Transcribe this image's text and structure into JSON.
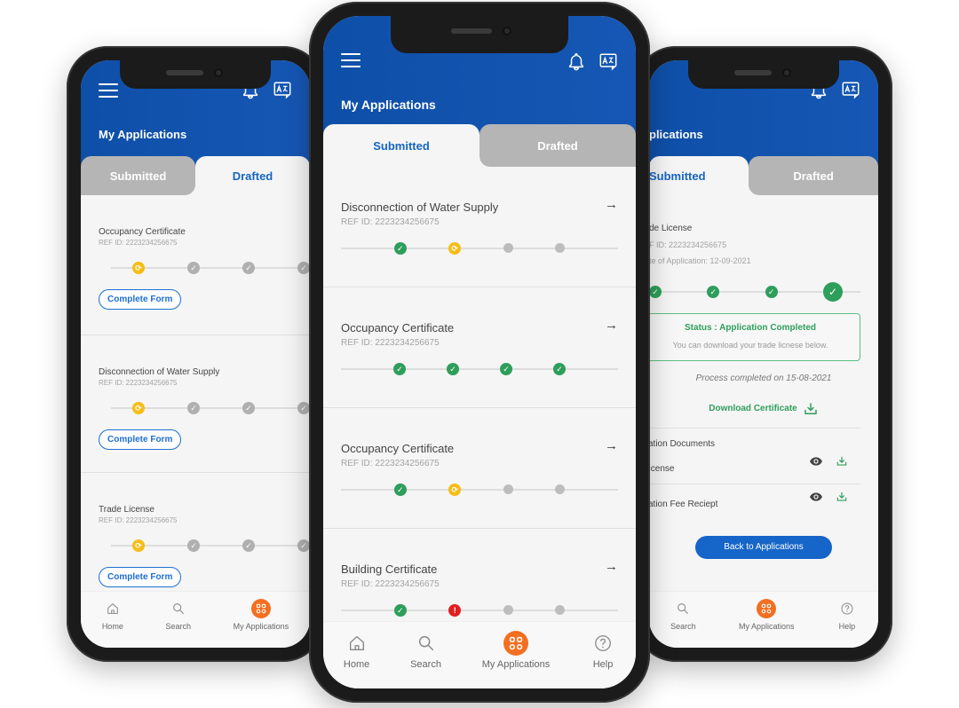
{
  "colors": {
    "primary": "#1657b5",
    "accent_orange": "#f36f21",
    "success": "#2e9e5b",
    "progress": "#f6bd16",
    "error": "#e02020",
    "pending": "#bdbdbd"
  },
  "phones": {
    "left": {
      "app_title": "My Applications",
      "tabs": [
        {
          "label": "Submitted",
          "active": false
        },
        {
          "label": "Drafted",
          "active": true
        }
      ],
      "cards": [
        {
          "name": "Occupancy Certificate",
          "ref": "REF ID: 2223234256675",
          "steps": [
            "progress",
            "pending-check",
            "pending-check",
            "pending-check"
          ],
          "action": "Complete Form"
        },
        {
          "name": "Disconnection of Water Supply",
          "ref": "REF ID: 2223234256675",
          "steps": [
            "progress",
            "pending-check",
            "pending-check",
            "pending-check"
          ],
          "action": "Complete Form"
        },
        {
          "name": "Trade License",
          "ref": "REF ID: 2223234256675",
          "steps": [
            "progress",
            "pending-check",
            "pending-check",
            "pending-check"
          ],
          "action": "Complete Form"
        }
      ],
      "nav": [
        {
          "label": "Home",
          "icon": "home-icon",
          "active": false
        },
        {
          "label": "Search",
          "icon": "search-icon",
          "active": false
        },
        {
          "label": "My Applications",
          "icon": "apps-icon",
          "active": true
        }
      ]
    },
    "center": {
      "app_title": "My Applications",
      "tabs": [
        {
          "label": "Submitted",
          "active": true
        },
        {
          "label": "Drafted",
          "active": false
        }
      ],
      "cards": [
        {
          "name": "Disconnection of Water Supply",
          "ref": "REF ID: 2223234256675",
          "steps": [
            "done",
            "progress",
            "pending",
            "pending"
          ]
        },
        {
          "name": "Occupancy Certificate",
          "ref": "REF ID: 2223234256675",
          "steps": [
            "done",
            "done",
            "done",
            "done"
          ]
        },
        {
          "name": "Occupancy Certificate",
          "ref": "REF ID: 2223234256675",
          "steps": [
            "done",
            "progress",
            "pending",
            "pending"
          ]
        },
        {
          "name": "Building Certificate",
          "ref": "REF ID: 2223234256675",
          "steps": [
            "done",
            "error",
            "pending",
            "pending"
          ]
        }
      ],
      "nav": [
        {
          "label": "Home",
          "icon": "home-icon",
          "active": false
        },
        {
          "label": "Search",
          "icon": "search-icon",
          "active": false
        },
        {
          "label": "My Applications",
          "icon": "apps-icon",
          "active": true
        },
        {
          "label": "Help",
          "icon": "help-icon",
          "active": false
        }
      ]
    },
    "right": {
      "app_title": "plications",
      "tabs": [
        {
          "label": "Submitted",
          "active": true
        },
        {
          "label": "Drafted",
          "active": false
        }
      ],
      "detail": {
        "name": "de License",
        "ref": "F ID: 2223234256675",
        "date": "te of Application: 12-09-2021",
        "steps": [
          "done",
          "done",
          "done",
          "done-big"
        ],
        "status_title": "Status : Application Completed",
        "status_desc": "You can download your trade licnese below.",
        "process_completed": "Process completed on 15-08-2021",
        "download_label": "Download Certificate",
        "docs_heading": "cation Documents",
        "documents": [
          {
            "name": "License"
          },
          {
            "name": "cation Fee Reciept"
          }
        ],
        "back_button": "Back to Applications"
      },
      "nav": [
        {
          "label": "Search",
          "icon": "search-icon",
          "active": false
        },
        {
          "label": "My Applications",
          "icon": "apps-icon",
          "active": true
        },
        {
          "label": "Help",
          "icon": "help-icon",
          "active": false
        }
      ]
    }
  }
}
